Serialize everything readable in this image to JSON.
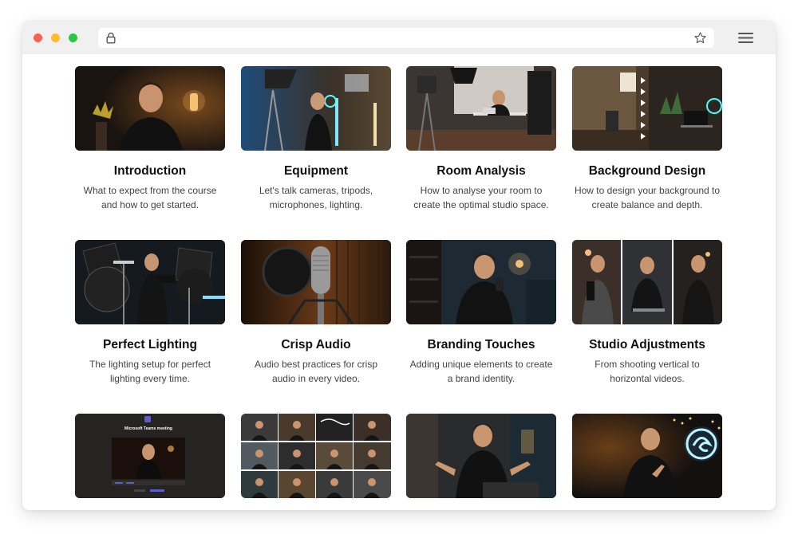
{
  "browser": {
    "url": "",
    "icons": {
      "lock": "lock-icon",
      "star": "star-icon",
      "menu": "hamburger-menu-icon"
    }
  },
  "lessons": [
    {
      "title": "Introduction",
      "description": "What to expect from the course and how to get started.",
      "thumb": "intro"
    },
    {
      "title": "Equipment",
      "description": "Let's talk cameras, tripods, microphones, lighting.",
      "thumb": "equipment"
    },
    {
      "title": "Room Analysis",
      "description": "How to analyse your room to create the optimal studio space.",
      "thumb": "room"
    },
    {
      "title": "Background Design",
      "description": "How to design your background to create balance and depth.",
      "thumb": "background"
    },
    {
      "title": "Perfect Lighting",
      "description": "The lighting setup for perfect lighting every time.",
      "thumb": "lighting"
    },
    {
      "title": "Crisp Audio",
      "description": "Audio best practices for crisp audio in every video.",
      "thumb": "audio"
    },
    {
      "title": "Branding Touches",
      "description": "Adding unique elements to create a brand identity.",
      "thumb": "branding"
    },
    {
      "title": "Studio Adjustments",
      "description": "From shooting vertical to horizontal videos.",
      "thumb": "adjust"
    },
    {
      "title": "",
      "description": "",
      "thumb": "teams",
      "screen_text": "Microsoft Teams meeting"
    },
    {
      "title": "",
      "description": "",
      "thumb": "grid"
    },
    {
      "title": "",
      "description": "",
      "thumb": "presenter"
    },
    {
      "title": "",
      "description": "",
      "thumb": "logo"
    }
  ]
}
